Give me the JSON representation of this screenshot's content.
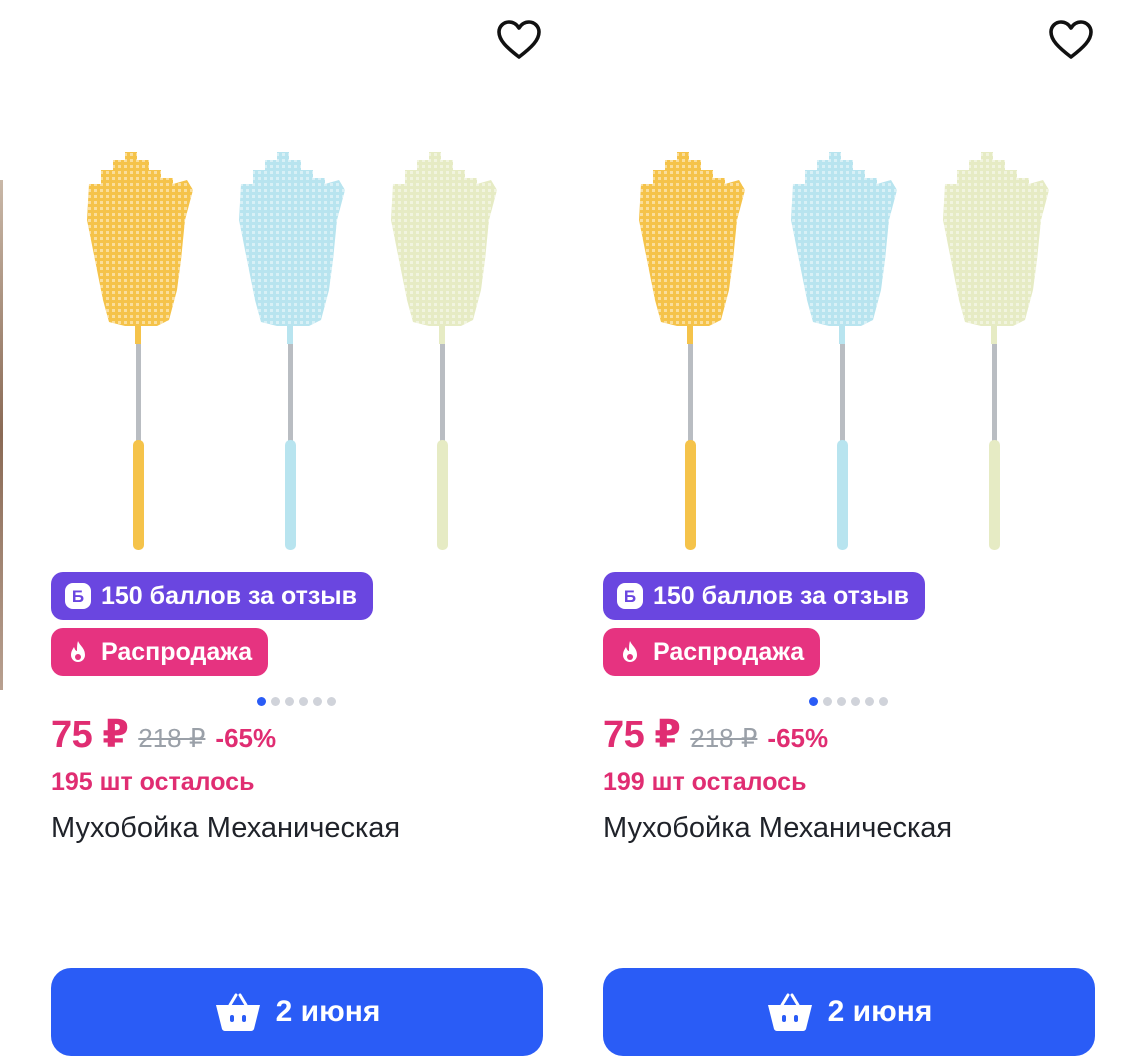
{
  "products": [
    {
      "name": "Мухобойка Механическая",
      "price": "75 ₽",
      "old_price": "218 ₽",
      "discount": "-65%",
      "stock": "195 шт осталось",
      "points_badge": "150 баллов за отзыв",
      "sale_badge": "Распродажа",
      "delivery_button": "2 июня",
      "image_count": 6,
      "active_image": 1
    },
    {
      "name": "Мухобойка Механическая",
      "price": "75 ₽",
      "old_price": "218 ₽",
      "discount": "-65%",
      "stock": "199 шт осталось",
      "points_badge": "150 баллов за отзыв",
      "sale_badge": "Распродажа",
      "delivery_button": "2 июня",
      "image_count": 6,
      "active_image": 1
    }
  ],
  "icons": {
    "favorite": "heart-outline-icon",
    "points": "points-b-icon",
    "sale": "flame-icon",
    "cart": "basket-icon"
  },
  "colors": {
    "accent_blue": "#2a5cf6",
    "price_pink": "#e02d72",
    "points_purple": "#6a46e0",
    "sale_pink": "#e63380",
    "swatter_yellow": "#f5c34a",
    "swatter_blue": "#b8e4ef",
    "swatter_cream": "#e6ebc4"
  }
}
